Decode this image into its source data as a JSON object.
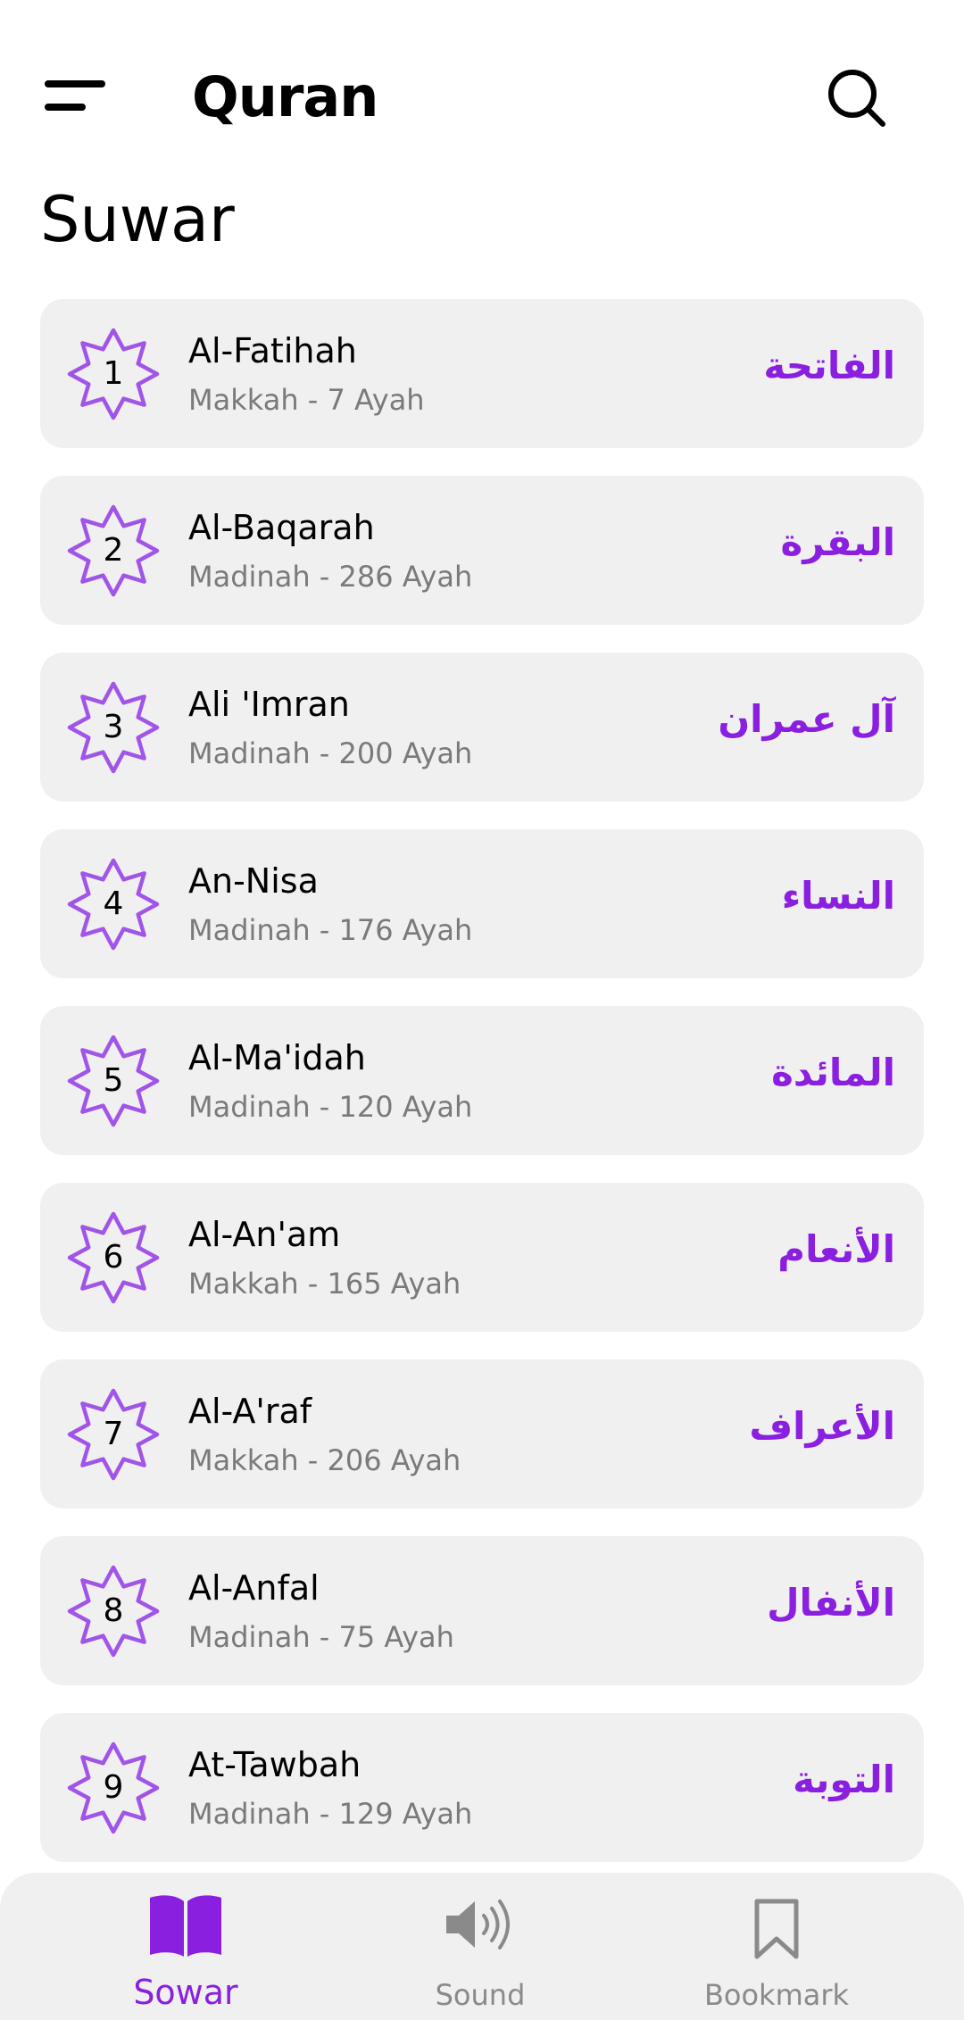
{
  "header": {
    "title": "Quran",
    "menu_icon": "menu-icon",
    "search_icon": "search-icon"
  },
  "section_title": "Suwar",
  "surahs": [
    {
      "number": "1",
      "name": "Al-Fatihah",
      "meta": "Makkah - 7 Ayah",
      "arabic": "الفاتحة"
    },
    {
      "number": "2",
      "name": "Al-Baqarah",
      "meta": "Madinah - 286 Ayah",
      "arabic": "البقرة"
    },
    {
      "number": "3",
      "name": "Ali 'Imran",
      "meta": "Madinah - 200 Ayah",
      "arabic": "آل عمران"
    },
    {
      "number": "4",
      "name": "An-Nisa",
      "meta": "Madinah - 176 Ayah",
      "arabic": "النساء"
    },
    {
      "number": "5",
      "name": "Al-Ma'idah",
      "meta": "Madinah - 120 Ayah",
      "arabic": "المائدة"
    },
    {
      "number": "6",
      "name": "Al-An'am",
      "meta": "Makkah - 165 Ayah",
      "arabic": "الأنعام"
    },
    {
      "number": "7",
      "name": "Al-A'raf",
      "meta": "Makkah - 206 Ayah",
      "arabic": "الأعراف"
    },
    {
      "number": "8",
      "name": "Al-Anfal",
      "meta": "Madinah - 75 Ayah",
      "arabic": "الأنفال"
    },
    {
      "number": "9",
      "name": "At-Tawbah",
      "meta": "Madinah - 129 Ayah",
      "arabic": "التوبة"
    }
  ],
  "bottom_nav": {
    "items": [
      {
        "label": "Sowar",
        "icon": "book-icon",
        "active": true
      },
      {
        "label": "Sound",
        "icon": "speaker-icon",
        "active": false
      },
      {
        "label": "Bookmark",
        "icon": "bookmark-icon",
        "active": false
      }
    ]
  },
  "colors": {
    "accent": "#8a1fe0",
    "star_outline": "#a155e8",
    "card_bg": "#f0f0f0",
    "meta_text": "#7a7a7a"
  }
}
